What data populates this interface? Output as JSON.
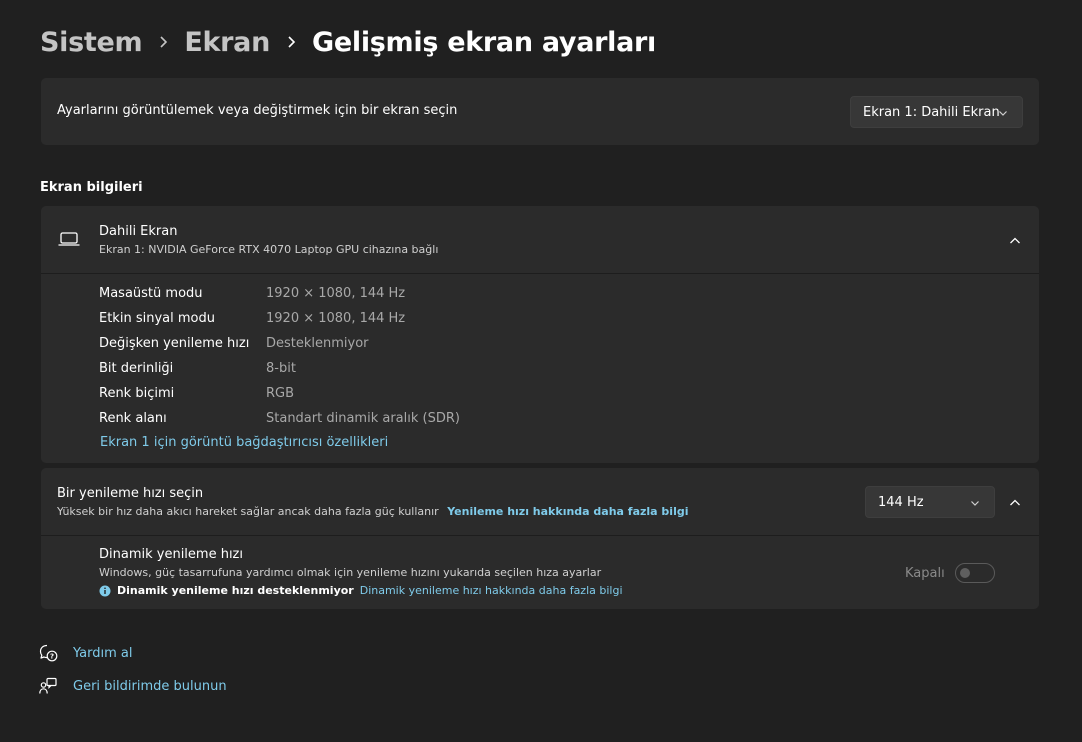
{
  "breadcrumb": {
    "items": [
      "Sistem",
      "Ekran",
      "Gelişmiş ekran ayarları"
    ]
  },
  "display_select": {
    "label": "Ayarlarını görüntülemek veya değiştirmek için bir ekran seçin",
    "selected": "Ekran 1: Dahili Ekran"
  },
  "display_info": {
    "section_title": "Ekran bilgileri",
    "name": "Dahili Ekran",
    "subtitle": "Ekran 1: NVIDIA GeForce RTX 4070 Laptop GPU cihazına bağlı",
    "properties": [
      {
        "label": "Masaüstü modu",
        "value": "1920 × 1080, 144 Hz"
      },
      {
        "label": "Etkin sinyal modu",
        "value": "1920 × 1080, 144 Hz"
      },
      {
        "label": "Değişken yenileme hızı",
        "value": "Desteklenmiyor"
      },
      {
        "label": "Bit derinliği",
        "value": "8-bit"
      },
      {
        "label": "Renk biçimi",
        "value": "RGB"
      },
      {
        "label": "Renk alanı",
        "value": "Standart dinamik aralık (SDR)"
      }
    ],
    "adapter_link": "Ekran 1 için görüntü bağdaştırıcısı özellikleri"
  },
  "refresh_rate": {
    "title": "Bir yenileme hızı seçin",
    "description": "Yüksek bir hız daha akıcı hareket sağlar ancak daha fazla güç kullanır",
    "learn_more_link": "Yenileme hızı hakkında daha fazla bilgi",
    "selected": "144 Hz"
  },
  "dynamic_refresh": {
    "title": "Dinamik yenileme hızı",
    "description": "Windows, güç tasarrufuna yardımcı olmak için yenileme hızını yukarıda seçilen hıza ayarlar",
    "info_text": "Dinamik yenileme hızı desteklenmiyor",
    "info_link": "Dinamik yenileme hızı hakkında daha fazla bilgi",
    "toggle_state": "Kapalı",
    "enabled": false
  },
  "footer": {
    "help": "Yardım al",
    "feedback": "Geri bildirimde bulunun"
  },
  "colors": {
    "background": "#202020",
    "card": "#2b2b2b",
    "accent_link": "#7fcbea"
  }
}
